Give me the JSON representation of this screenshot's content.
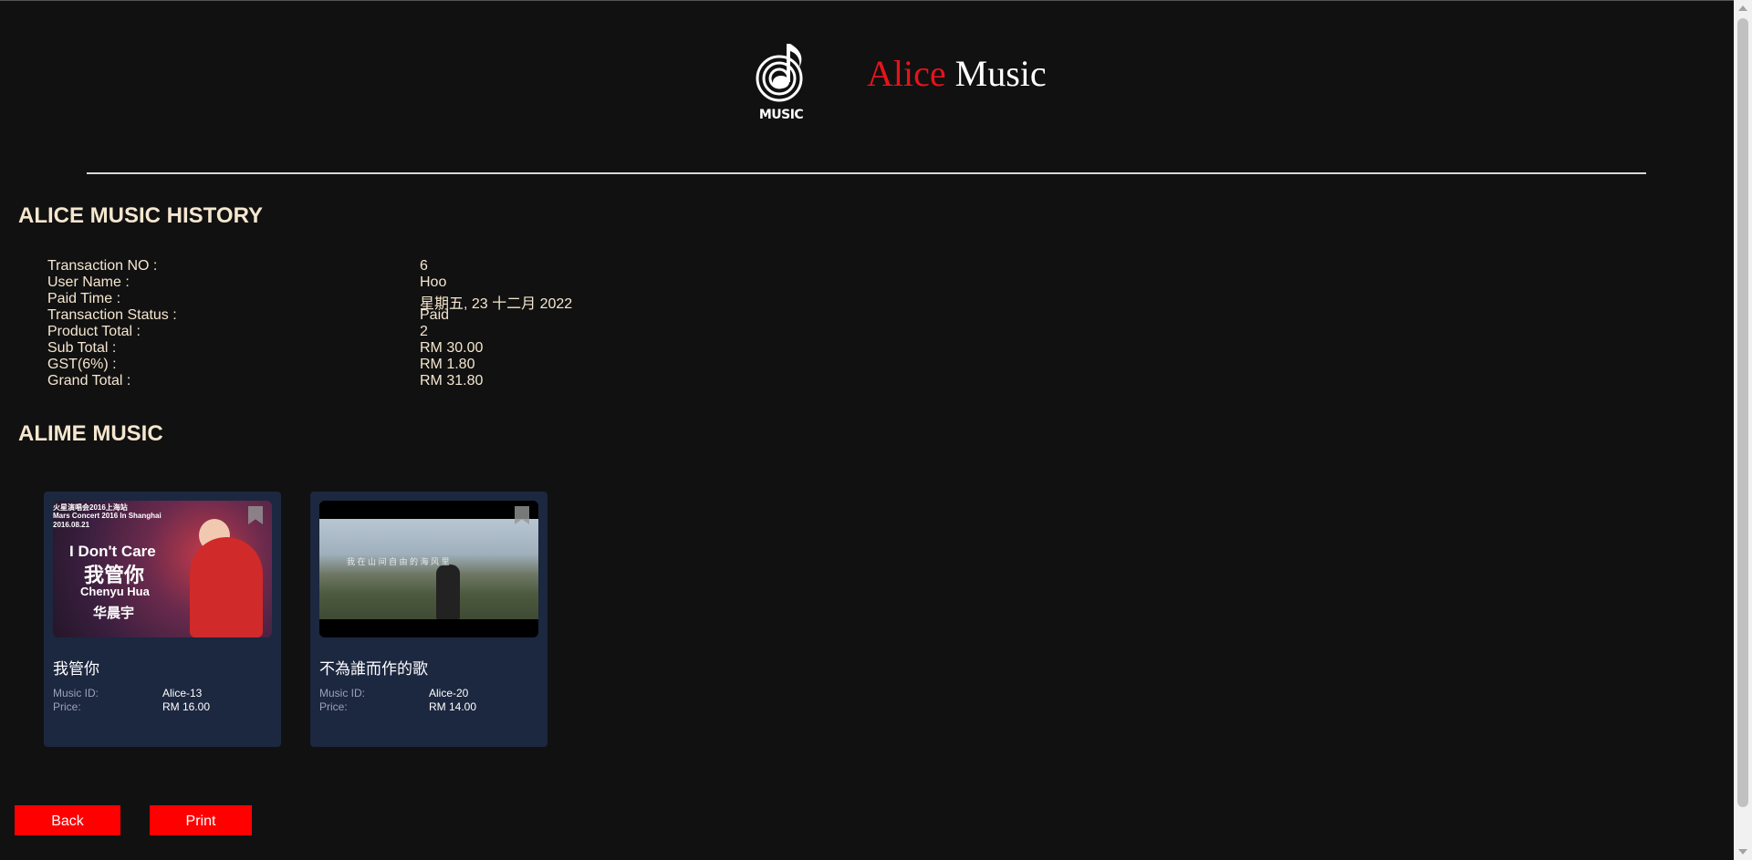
{
  "brand": {
    "logo_text": "MUSIC",
    "name_first": "Alice",
    "name_second": "Music",
    "accent_color": "#e5141b"
  },
  "history": {
    "heading": "ALICE MUSIC HISTORY",
    "rows": [
      {
        "label": "Transaction NO :",
        "value": "6"
      },
      {
        "label": "User Name :",
        "value": "Hoo"
      },
      {
        "label": "Paid Time :",
        "value": "星期五, 23 十二月 2022"
      },
      {
        "label": "Transaction Status :",
        "value": "Paid"
      },
      {
        "label": "Product Total :",
        "value": "2"
      },
      {
        "label": "Sub Total :",
        "value": "RM 30.00"
      },
      {
        "label": "GST(6%) :",
        "value": "RM 1.80"
      },
      {
        "label": "Grand Total :",
        "value": "RM 31.80"
      }
    ]
  },
  "music": {
    "heading": "ALIME MUSIC",
    "items": [
      {
        "title": "我管你",
        "id_label": "Music ID:",
        "id": "Alice-13",
        "price_label": "Price:",
        "price": "RM 16.00",
        "thumb_text": {
          "line1": "火星演唱会2016上海站",
          "line2": "Mars Concert 2016 In Shanghai",
          "line3": "2016.08.21",
          "title_en": "I Don't Care",
          "title_cn": "我管你",
          "artist_en": "Chenyu Hua",
          "artist_cn": "华晨宇"
        }
      },
      {
        "title": "不為誰而作的歌",
        "id_label": "Music ID:",
        "id": "Alice-20",
        "price_label": "Price:",
        "price": "RM 14.00",
        "thumb_text": {
          "caption": "我 在 山 间 自 由 的 海 风 里"
        }
      }
    ]
  },
  "actions": {
    "back_label": "Back",
    "print_label": "Print",
    "button_color": "#ff0000"
  }
}
